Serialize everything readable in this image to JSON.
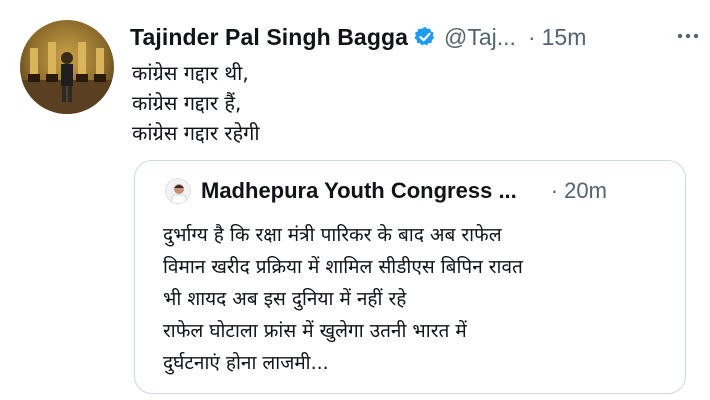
{
  "tweet": {
    "author_name": "Tajinder Pal Singh Bagga",
    "handle": "@Taj...",
    "separator": "·",
    "time": "15m",
    "verified_color": "#1d9bf0",
    "lines": [
      "कांग्रेस गद्दार थी,",
      "कांग्रेस गद्दार हैं,",
      "कांग्रेस गद्दार रहेगी"
    ]
  },
  "quoted_tweet": {
    "author_name": "Madhepura Youth Congress ...",
    "separator": "·",
    "time": "20m",
    "lines": [
      "दुर्भाग्य है कि रक्षा मंत्री पारिकर के बाद अब राफेल",
      "विमान खरीद प्रक्रिया में शामिल सीडीएस बिपिन रावत",
      "भी शायद अब इस दुनिया में नहीं रहे",
      "राफेल घोटाला फ्रांस में खुलेगा उतनी भारत में",
      "दुर्घटनाएं होना लाजमी..."
    ]
  },
  "icons": {
    "verified": "verified-badge-icon",
    "more": "more-options-icon"
  }
}
